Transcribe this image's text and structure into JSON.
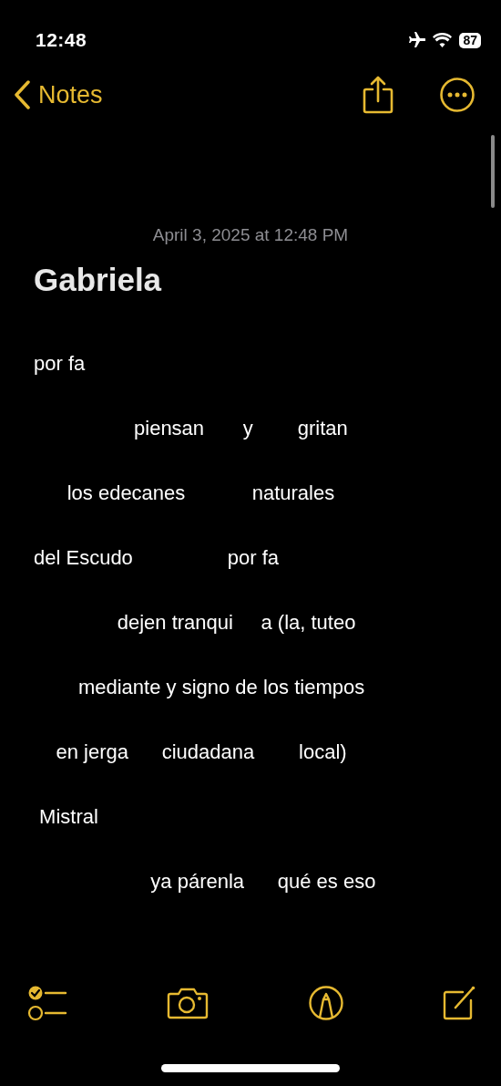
{
  "status_bar": {
    "time": "12:48",
    "battery": "87"
  },
  "nav": {
    "back_label": "Notes"
  },
  "note": {
    "date": "April 3, 2025 at 12:48 PM",
    "title": "Gabriela",
    "lines": [
      "por fa",
      "                  piensan       y        gritan",
      "      los edecanes            naturales",
      "del Escudo                 por fa",
      "               dejen tranqui     a (la, tuteo",
      "        mediante y signo de los tiempos",
      "    en jerga      ciudadana        local)",
      " Mistral",
      "                     ya párenla      qué es eso"
    ]
  }
}
